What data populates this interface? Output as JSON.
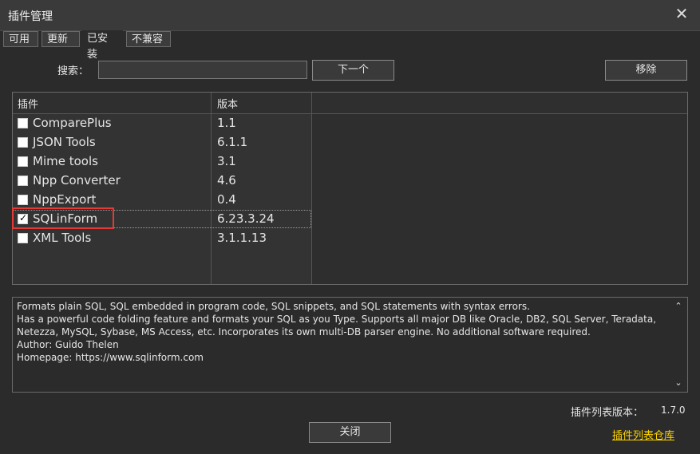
{
  "window": {
    "title": "插件管理",
    "close_glyph": "✕"
  },
  "tabs": [
    {
      "label": "可用",
      "active": false
    },
    {
      "label": "更新",
      "active": false
    },
    {
      "label": "已安装",
      "active": true
    },
    {
      "label": "不兼容",
      "active": false
    }
  ],
  "search": {
    "label": "搜索：",
    "value": ""
  },
  "buttons": {
    "next": "下一个",
    "remove": "移除",
    "close": "关闭"
  },
  "table": {
    "headers": [
      "插件",
      "版本"
    ],
    "rows": [
      {
        "name": "ComparePlus",
        "version": "1.1",
        "checked": false
      },
      {
        "name": "JSON Tools",
        "version": "6.1.1",
        "checked": false
      },
      {
        "name": "Mime tools",
        "version": "3.1",
        "checked": false
      },
      {
        "name": "Npp Converter",
        "version": "4.6",
        "checked": false
      },
      {
        "name": "NppExport",
        "version": "0.4",
        "checked": false
      },
      {
        "name": "SQLinForm",
        "version": "6.23.3.24",
        "checked": true
      },
      {
        "name": "XML Tools",
        "version": "3.1.1.13",
        "checked": false
      }
    ]
  },
  "description": {
    "lines": [
      "Formats plain SQL, SQL embedded in program code, SQL snippets, and SQL statements with syntax errors.",
      "Has a powerful code folding feature and formats your SQL as you Type. Supports all major DB like Oracle, DB2, SQL Server, Teradata,",
      "Netezza, MySQL, Sybase, MS Access, etc. Incorporates its own multi-DB parser engine. No additional software required.",
      "Author: Guido Thelen",
      "Homepage: https://www.sqlinform.com"
    ]
  },
  "footer": {
    "list_version_label": "插件列表版本：",
    "list_version_value": "1.7.0",
    "repo_link": "插件列表仓库"
  },
  "colors": {
    "highlight": "#e53935",
    "link": "#ffd600"
  },
  "icons": {
    "checkbox_tick": "✓",
    "scroll_up": "⌃",
    "scroll_down": "⌄"
  }
}
